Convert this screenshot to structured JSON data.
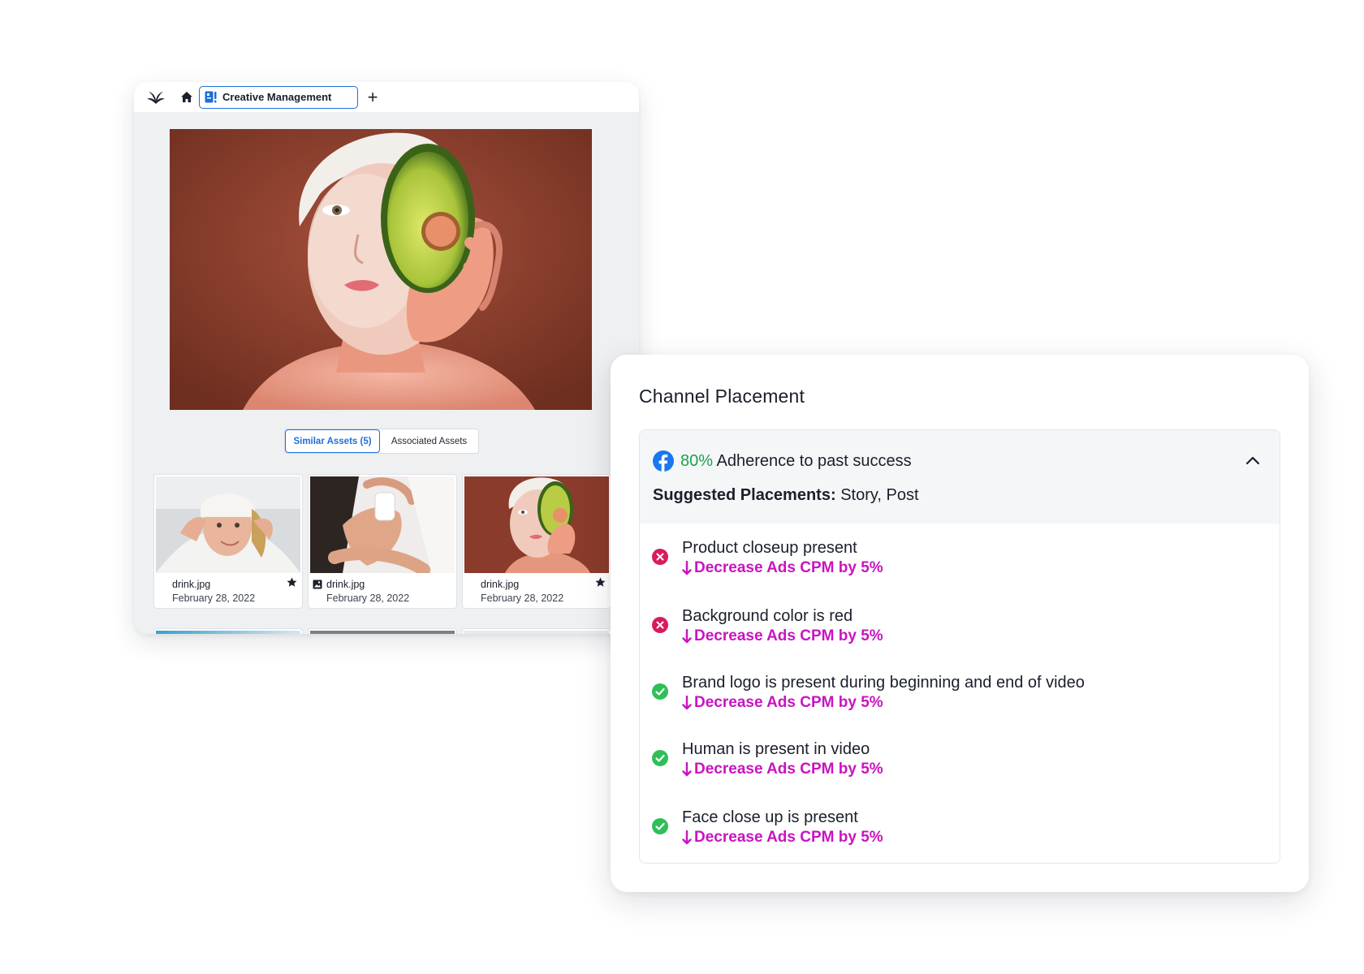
{
  "app_window": {
    "tab_label": "Creative Management",
    "add_tab_label": "+",
    "toggle": {
      "similar_label": "Similar Assets (5)",
      "associated_label": "Associated Assets"
    },
    "assets": [
      {
        "name": "drink.jpg",
        "date": "February 28, 2022",
        "icon": "star-icon"
      },
      {
        "name": "drink.jpg",
        "date": "February 28, 2022",
        "icon": "image-icon"
      },
      {
        "name": "drink.jpg",
        "date": "February 28, 2022",
        "icon": "star-icon"
      }
    ]
  },
  "placement_panel": {
    "title": "Channel Placement",
    "channel_icon": "facebook-icon",
    "adherence_percent": "80%",
    "adherence_text": "Adherence to past success",
    "suggested_label": "Suggested Placements:",
    "suggested_value": "Story, Post",
    "criteria": [
      {
        "title": "Product closeup present",
        "impact": "Decrease Ads CPM by 5%",
        "status": "fail"
      },
      {
        "title": "Background color is red",
        "impact": "Decrease Ads CPM by 5%",
        "status": "fail"
      },
      {
        "title": "Brand logo is present during beginning and end of video",
        "impact": "Decrease Ads CPM by 5%",
        "status": "pass"
      },
      {
        "title": "Human is present in video",
        "impact": "Decrease Ads CPM by 5%",
        "status": "pass"
      },
      {
        "title": "Face close up is present",
        "impact": "Decrease Ads CPM by 5%",
        "status": "pass"
      }
    ]
  },
  "colors": {
    "accent_blue": "#1e6fd9",
    "success_green": "#1aa24a",
    "fail_red": "#d81b60",
    "impact_magenta": "#c914c0"
  }
}
